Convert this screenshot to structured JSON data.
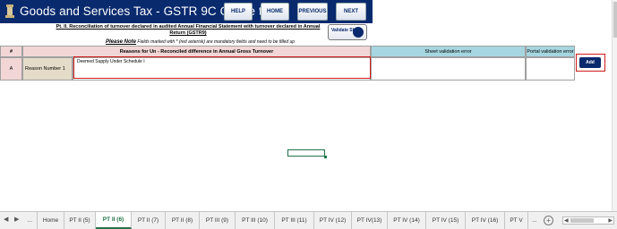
{
  "header": {
    "title": "Goods and Services Tax - GSTR 9C Offline tool",
    "buttons": [
      "HELP",
      "HOME",
      "PREVIOUS",
      "NEXT"
    ],
    "bg_color": "#0a2a6e"
  },
  "subtitle": "Pt. II. Reconciliation of turnover declared in audited Annual Financial Statement with turnover declared in Annual Return (GSTR9)",
  "note": {
    "label": "Please Note",
    "text": "Fields marked with * (red asterisk) are mandatory fields and need to be filled up"
  },
  "validate_button": "Validate Sheet",
  "table": {
    "headers": [
      "#",
      "Reasons for Un - Reconciled difference in Annual Gross Turnover",
      "Sheet validation error",
      "Portal validation error"
    ],
    "row": {
      "num": "A",
      "label": "Reason Number 1",
      "value": "Deemed Supply Under Schedule I",
      "sheet_error": "",
      "portal_error": ""
    }
  },
  "add_button": "Add",
  "tabs": {
    "ellipsis": "...",
    "items": [
      "Home",
      "PT II (5)",
      "PT II (6)",
      "PT II (7)",
      "PT II (8)",
      "PT III (9)",
      "PT III (10)",
      "PT III (11)",
      "PT IV (12)",
      "PT IV(13)",
      "PT IV (14)",
      "PT IV (15)",
      "PT IV (16)",
      "PT V"
    ],
    "active": "PT II (6)",
    "more": "...",
    "add": "+"
  }
}
